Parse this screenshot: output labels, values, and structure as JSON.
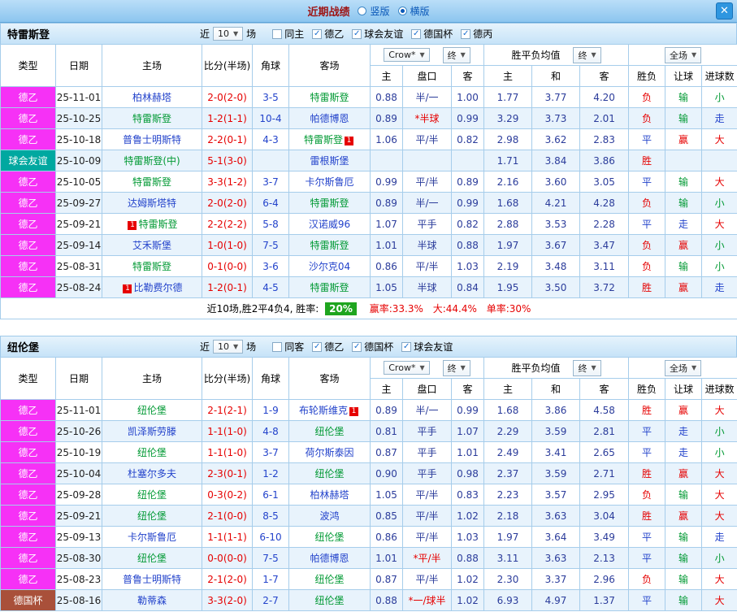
{
  "palette": {
    "r": "#e60000",
    "g": "#009933",
    "b": "#2343cb",
    "navy": "#2b3c9b"
  },
  "header": {
    "title": "近期战绩",
    "options": [
      {
        "label": "竖版",
        "selected": false
      },
      {
        "label": "横版",
        "selected": true
      }
    ],
    "close_glyph": "✕"
  },
  "ui": {
    "near_label": "近",
    "matches_label": "场"
  },
  "table_header": {
    "cols": [
      "类型",
      "日期",
      "主场",
      "比分(半场)",
      "角球",
      "客场"
    ],
    "sub": [
      "主",
      "盘口",
      "客",
      "主",
      "和",
      "客",
      "胜负",
      "让球",
      "进球数"
    ],
    "odds_source": "Crow*",
    "final_label": "终",
    "avg_label": "胜平负均值",
    "full_label": "全场",
    "arrow": "▼"
  },
  "sections": [
    {
      "team": "特雷斯登",
      "filter": {
        "count": "10",
        "checkboxes": [
          {
            "label": "同主",
            "checked": false
          },
          {
            "label": "德乙",
            "checked": true
          },
          {
            "label": "球会友谊",
            "checked": true
          },
          {
            "label": "德国杯",
            "checked": true
          },
          {
            "label": "德丙",
            "checked": true
          }
        ]
      },
      "rows": [
        {
          "type": "德乙",
          "tc": "#f631f6",
          "date": "25-11-01",
          "home": {
            "n": "柏林赫塔",
            "s": 0
          },
          "score": "2-0(2-0)",
          "corner": "3-5",
          "away": {
            "n": "特雷斯登",
            "s": 1
          },
          "asia": [
            "0.88",
            "半/一",
            "1.00"
          ],
          "star": 0,
          "euro": [
            "1.77",
            "3.77",
            "4.20"
          ],
          "res": [
            "负",
            "r"
          ],
          "let": [
            "输",
            "g"
          ],
          "goal": [
            "小",
            "g"
          ]
        },
        {
          "type": "德乙",
          "tc": "#f631f6",
          "date": "25-10-25",
          "home": {
            "n": "特雷斯登",
            "s": 1
          },
          "score": "1-2(1-1)",
          "corner": "10-4",
          "away": {
            "n": "帕德博恩",
            "s": 0
          },
          "asia": [
            "0.89",
            "*半球",
            "0.99"
          ],
          "star": 1,
          "euro": [
            "3.29",
            "3.73",
            "2.01"
          ],
          "res": [
            "负",
            "r"
          ],
          "let": [
            "输",
            "g"
          ],
          "goal": [
            "走",
            "b"
          ]
        },
        {
          "type": "德乙",
          "tc": "#f631f6",
          "date": "25-10-18",
          "home": {
            "n": "普鲁士明斯特",
            "s": 0
          },
          "score": "2-2(0-1)",
          "corner": "4-3",
          "away": {
            "n": "特雷斯登",
            "s": 1,
            "b": "post"
          },
          "asia": [
            "1.06",
            "平/半",
            "0.82"
          ],
          "star": 0,
          "euro": [
            "2.98",
            "3.62",
            "2.83"
          ],
          "res": [
            "平",
            "b"
          ],
          "let": [
            "赢",
            "r"
          ],
          "goal": [
            "大",
            "r"
          ]
        },
        {
          "type": "球会友谊",
          "tc": "#00a8a0",
          "date": "25-10-09",
          "home": {
            "n": "特雷斯登(中)",
            "s": 1
          },
          "score": "5-1(3-0)",
          "corner": "",
          "away": {
            "n": "雷根斯堡",
            "s": 0
          },
          "asia": [
            "",
            "",
            ""
          ],
          "star": 0,
          "euro": [
            "1.71",
            "3.84",
            "3.86"
          ],
          "res": [
            "胜",
            "r"
          ],
          "let": [
            "",
            ""
          ],
          "goal": [
            "",
            ""
          ]
        },
        {
          "type": "德乙",
          "tc": "#f631f6",
          "date": "25-10-05",
          "home": {
            "n": "特雷斯登",
            "s": 1
          },
          "score": "3-3(1-2)",
          "corner": "3-7",
          "away": {
            "n": "卡尔斯鲁厄",
            "s": 0
          },
          "asia": [
            "0.99",
            "平/半",
            "0.89"
          ],
          "star": 0,
          "euro": [
            "2.16",
            "3.60",
            "3.05"
          ],
          "res": [
            "平",
            "b"
          ],
          "let": [
            "输",
            "g"
          ],
          "goal": [
            "大",
            "r"
          ]
        },
        {
          "type": "德乙",
          "tc": "#f631f6",
          "date": "25-09-27",
          "home": {
            "n": "达姆斯塔特",
            "s": 0
          },
          "score": "2-0(2-0)",
          "corner": "6-4",
          "away": {
            "n": "特雷斯登",
            "s": 1
          },
          "asia": [
            "0.89",
            "半/一",
            "0.99"
          ],
          "star": 0,
          "euro": [
            "1.68",
            "4.21",
            "4.28"
          ],
          "res": [
            "负",
            "r"
          ],
          "let": [
            "输",
            "g"
          ],
          "goal": [
            "小",
            "g"
          ]
        },
        {
          "type": "德乙",
          "tc": "#f631f6",
          "date": "25-09-21",
          "home": {
            "n": "特雷斯登",
            "s": 1,
            "b": "pre"
          },
          "score": "2-2(2-2)",
          "corner": "5-8",
          "away": {
            "n": "汉诺威96",
            "s": 0
          },
          "asia": [
            "1.07",
            "平手",
            "0.82"
          ],
          "star": 0,
          "euro": [
            "2.88",
            "3.53",
            "2.28"
          ],
          "res": [
            "平",
            "b"
          ],
          "let": [
            "走",
            "b"
          ],
          "goal": [
            "大",
            "r"
          ]
        },
        {
          "type": "德乙",
          "tc": "#f631f6",
          "date": "25-09-14",
          "home": {
            "n": "艾禾斯堡",
            "s": 0
          },
          "score": "1-0(1-0)",
          "corner": "7-5",
          "away": {
            "n": "特雷斯登",
            "s": 1
          },
          "asia": [
            "1.01",
            "半球",
            "0.88"
          ],
          "star": 0,
          "euro": [
            "1.97",
            "3.67",
            "3.47"
          ],
          "res": [
            "负",
            "r"
          ],
          "let": [
            "赢",
            "r"
          ],
          "goal": [
            "小",
            "g"
          ]
        },
        {
          "type": "德乙",
          "tc": "#f631f6",
          "date": "25-08-31",
          "home": {
            "n": "特雷斯登",
            "s": 1
          },
          "score": "0-1(0-0)",
          "corner": "3-6",
          "away": {
            "n": "沙尔克04",
            "s": 0
          },
          "asia": [
            "0.86",
            "平/半",
            "1.03"
          ],
          "star": 0,
          "euro": [
            "2.19",
            "3.48",
            "3.11"
          ],
          "res": [
            "负",
            "r"
          ],
          "let": [
            "输",
            "g"
          ],
          "goal": [
            "小",
            "g"
          ]
        },
        {
          "type": "德乙",
          "tc": "#f631f6",
          "date": "25-08-24",
          "home": {
            "n": "比勒费尔德",
            "s": 0,
            "b": "pre"
          },
          "score": "1-2(0-1)",
          "corner": "4-5",
          "away": {
            "n": "特雷斯登",
            "s": 1
          },
          "asia": [
            "1.05",
            "半球",
            "0.84"
          ],
          "star": 0,
          "euro": [
            "1.95",
            "3.50",
            "3.72"
          ],
          "res": [
            "胜",
            "r"
          ],
          "let": [
            "赢",
            "r"
          ],
          "goal": [
            "走",
            "b"
          ]
        }
      ],
      "summary": {
        "prefix": "近10场,胜2平4负4, 胜率:",
        "badge": "20%",
        "stats": [
          "赢率:33.3%",
          "大:44.4%",
          "单率:30%"
        ]
      }
    },
    {
      "team": "纽伦堡",
      "filter": {
        "count": "10",
        "checkboxes": [
          {
            "label": "同客",
            "checked": false
          },
          {
            "label": "德乙",
            "checked": true
          },
          {
            "label": "德国杯",
            "checked": true
          },
          {
            "label": "球会友谊",
            "checked": true
          }
        ]
      },
      "rows": [
        {
          "type": "德乙",
          "tc": "#f631f6",
          "date": "25-11-01",
          "home": {
            "n": "纽伦堡",
            "s": 1
          },
          "score": "2-1(2-1)",
          "corner": "1-9",
          "away": {
            "n": "布轮斯维克",
            "s": 0,
            "b": "post"
          },
          "asia": [
            "0.89",
            "半/一",
            "0.99"
          ],
          "star": 0,
          "euro": [
            "1.68",
            "3.86",
            "4.58"
          ],
          "res": [
            "胜",
            "r"
          ],
          "let": [
            "赢",
            "r"
          ],
          "goal": [
            "大",
            "r"
          ]
        },
        {
          "type": "德乙",
          "tc": "#f631f6",
          "date": "25-10-26",
          "home": {
            "n": "凯泽斯劳滕",
            "s": 0
          },
          "score": "1-1(1-0)",
          "corner": "4-8",
          "away": {
            "n": "纽伦堡",
            "s": 1
          },
          "asia": [
            "0.81",
            "平手",
            "1.07"
          ],
          "star": 0,
          "euro": [
            "2.29",
            "3.59",
            "2.81"
          ],
          "res": [
            "平",
            "b"
          ],
          "let": [
            "走",
            "b"
          ],
          "goal": [
            "小",
            "g"
          ]
        },
        {
          "type": "德乙",
          "tc": "#f631f6",
          "date": "25-10-19",
          "home": {
            "n": "纽伦堡",
            "s": 1
          },
          "score": "1-1(1-0)",
          "corner": "3-7",
          "away": {
            "n": "荷尔斯泰因",
            "s": 0
          },
          "asia": [
            "0.87",
            "平手",
            "1.01"
          ],
          "star": 0,
          "euro": [
            "2.49",
            "3.41",
            "2.65"
          ],
          "res": [
            "平",
            "b"
          ],
          "let": [
            "走",
            "b"
          ],
          "goal": [
            "小",
            "g"
          ]
        },
        {
          "type": "德乙",
          "tc": "#f631f6",
          "date": "25-10-04",
          "home": {
            "n": "杜塞尔多夫",
            "s": 0
          },
          "score": "2-3(0-1)",
          "corner": "1-2",
          "away": {
            "n": "纽伦堡",
            "s": 1
          },
          "asia": [
            "0.90",
            "平手",
            "0.98"
          ],
          "star": 0,
          "euro": [
            "2.37",
            "3.59",
            "2.71"
          ],
          "res": [
            "胜",
            "r"
          ],
          "let": [
            "赢",
            "r"
          ],
          "goal": [
            "大",
            "r"
          ]
        },
        {
          "type": "德乙",
          "tc": "#f631f6",
          "date": "25-09-28",
          "home": {
            "n": "纽伦堡",
            "s": 1
          },
          "score": "0-3(0-2)",
          "corner": "6-1",
          "away": {
            "n": "柏林赫塔",
            "s": 0
          },
          "asia": [
            "1.05",
            "平/半",
            "0.83"
          ],
          "star": 0,
          "euro": [
            "2.23",
            "3.57",
            "2.95"
          ],
          "res": [
            "负",
            "r"
          ],
          "let": [
            "输",
            "g"
          ],
          "goal": [
            "大",
            "r"
          ]
        },
        {
          "type": "德乙",
          "tc": "#f631f6",
          "date": "25-09-21",
          "home": {
            "n": "纽伦堡",
            "s": 1
          },
          "score": "2-1(0-0)",
          "corner": "8-5",
          "away": {
            "n": "波鸿",
            "s": 0
          },
          "asia": [
            "0.85",
            "平/半",
            "1.02"
          ],
          "star": 0,
          "euro": [
            "2.18",
            "3.63",
            "3.04"
          ],
          "res": [
            "胜",
            "r"
          ],
          "let": [
            "赢",
            "r"
          ],
          "goal": [
            "大",
            "r"
          ]
        },
        {
          "type": "德乙",
          "tc": "#f631f6",
          "date": "25-09-13",
          "home": {
            "n": "卡尔斯鲁厄",
            "s": 0
          },
          "score": "1-1(1-1)",
          "corner": "6-10",
          "away": {
            "n": "纽伦堡",
            "s": 1
          },
          "asia": [
            "0.86",
            "平/半",
            "1.03"
          ],
          "star": 0,
          "euro": [
            "1.97",
            "3.64",
            "3.49"
          ],
          "res": [
            "平",
            "b"
          ],
          "let": [
            "输",
            "g"
          ],
          "goal": [
            "走",
            "b"
          ]
        },
        {
          "type": "德乙",
          "tc": "#f631f6",
          "date": "25-08-30",
          "home": {
            "n": "纽伦堡",
            "s": 1
          },
          "score": "0-0(0-0)",
          "corner": "7-5",
          "away": {
            "n": "帕德博恩",
            "s": 0
          },
          "asia": [
            "1.01",
            "*平/半",
            "0.88"
          ],
          "star": 1,
          "euro": [
            "3.11",
            "3.63",
            "2.13"
          ],
          "res": [
            "平",
            "b"
          ],
          "let": [
            "输",
            "g"
          ],
          "goal": [
            "小",
            "g"
          ]
        },
        {
          "type": "德乙",
          "tc": "#f631f6",
          "date": "25-08-23",
          "home": {
            "n": "普鲁士明斯特",
            "s": 0
          },
          "score": "2-1(2-0)",
          "corner": "1-7",
          "away": {
            "n": "纽伦堡",
            "s": 1
          },
          "asia": [
            "0.87",
            "平/半",
            "1.02"
          ],
          "star": 0,
          "euro": [
            "2.30",
            "3.37",
            "2.96"
          ],
          "res": [
            "负",
            "r"
          ],
          "let": [
            "输",
            "g"
          ],
          "goal": [
            "大",
            "r"
          ]
        },
        {
          "type": "德国杯",
          "tc": "#a9503a",
          "date": "25-08-16",
          "home": {
            "n": "勒蒂森",
            "s": 0
          },
          "score": "3-3(2-0)",
          "corner": "2-7",
          "away": {
            "n": "纽伦堡",
            "s": 1
          },
          "asia": [
            "0.88",
            "*一/球半",
            "1.02"
          ],
          "star": 1,
          "euro": [
            "6.93",
            "4.97",
            "1.37"
          ],
          "res": [
            "平",
            "b"
          ],
          "let": [
            "输",
            "g"
          ],
          "goal": [
            "大",
            "r"
          ]
        }
      ]
    }
  ]
}
